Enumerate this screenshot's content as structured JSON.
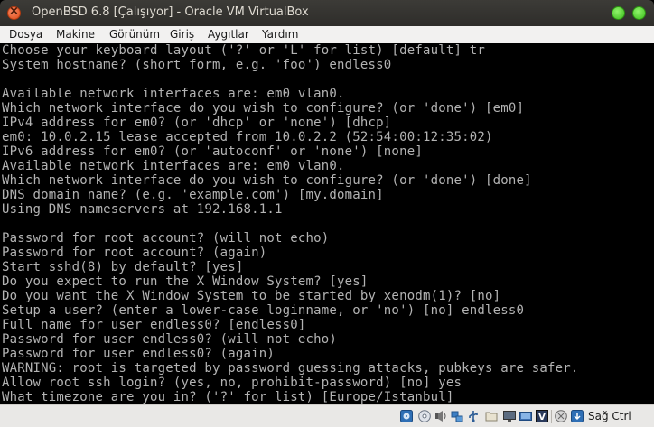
{
  "window": {
    "title": "OpenBSD 6.8 [Çalışıyor] - Oracle VM VirtualBox"
  },
  "menu": {
    "items": [
      "Dosya",
      "Makine",
      "Görünüm",
      "Giriş",
      "Aygıtlar",
      "Yardım"
    ]
  },
  "console": {
    "lines": [
      "Choose your keyboard layout ('?' or 'L' for list) [default] tr",
      "System hostname? (short form, e.g. 'foo') endless0",
      "",
      "Available network interfaces are: em0 vlan0.",
      "Which network interface do you wish to configure? (or 'done') [em0]",
      "IPv4 address for em0? (or 'dhcp' or 'none') [dhcp]",
      "em0: 10.0.2.15 lease accepted from 10.0.2.2 (52:54:00:12:35:02)",
      "IPv6 address for em0? (or 'autoconf' or 'none') [none]",
      "Available network interfaces are: em0 vlan0.",
      "Which network interface do you wish to configure? (or 'done') [done]",
      "DNS domain name? (e.g. 'example.com') [my.domain]",
      "Using DNS nameservers at 192.168.1.1",
      "",
      "Password for root account? (will not echo)",
      "Password for root account? (again)",
      "Start sshd(8) by default? [yes]",
      "Do you expect to run the X Window System? [yes]",
      "Do you want the X Window System to be started by xenodm(1)? [no]",
      "Setup a user? (enter a lower-case loginname, or 'no') [no] endless0",
      "Full name for user endless0? [endless0]",
      "Password for user endless0? (will not echo)",
      "Password for user endless0? (again)",
      "WARNING: root is targeted by password guessing attacks, pubkeys are safer.",
      "Allow root ssh login? (yes, no, prohibit-password) [no] yes",
      "What timezone are you in? ('?' for list) [Europe/Istanbul]"
    ]
  },
  "statusbar": {
    "icons": [
      "hard-disk-icon",
      "optical-drive-icon",
      "audio-icon",
      "network-icon",
      "usb-icon",
      "shared-folders-icon",
      "display-icon",
      "video-capture-icon",
      "virtualization-icon",
      "mouse-integration-icon",
      "keyboard-capture-icon"
    ],
    "host_key": "Sağ Ctrl"
  }
}
